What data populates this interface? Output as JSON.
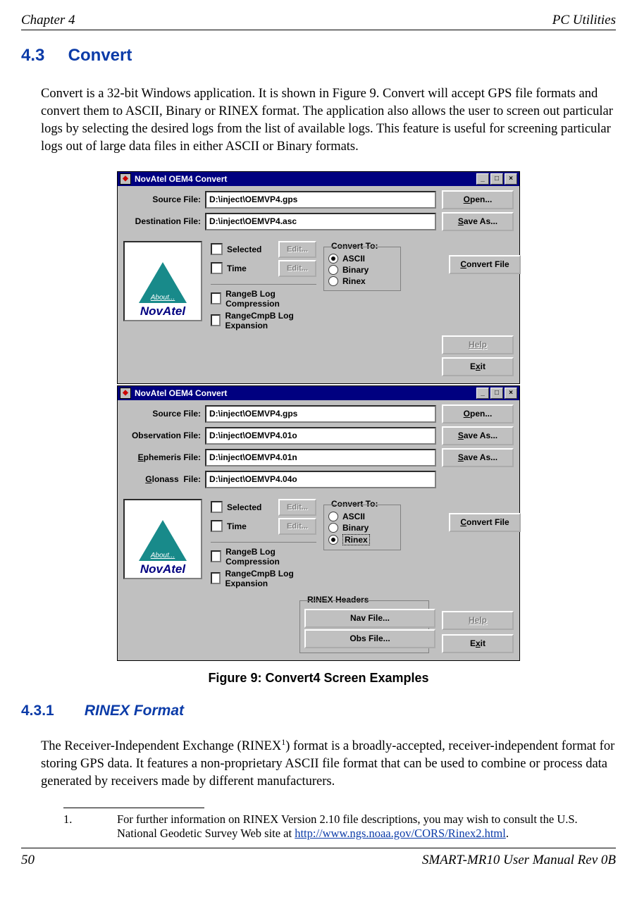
{
  "header": {
    "left": "Chapter 4",
    "right": "PC Utilities"
  },
  "section": {
    "num": "4.3",
    "title": "Convert"
  },
  "para1": "Convert is a 32-bit Windows application. It is shown in Figure 9. Convert will accept GPS file formats and convert them to ASCII, Binary or RINEX format. The application also allows the user to screen out particular logs by selecting the desired logs from the list of available logs. This feature is useful for screening particular logs out of large data files in either ASCII or Binary formats.",
  "figure_caption": "Figure 9: Convert4 Screen Examples",
  "win_title": "NovAtel OEM4 Convert",
  "labels": {
    "source": "Source File:",
    "dest": "Destination File:",
    "obs": "Observation File:",
    "eph": "Ephemeris File:",
    "glo": "Glonass  File:",
    "open": "Open...",
    "saveas": "Save As...",
    "selected": "Selected",
    "time": "Time",
    "edit": "Edit...",
    "rangeb": "RangeB Log Compression",
    "rangecmp": "RangeCmpB Log Expansion",
    "convert_to": "Convert To:",
    "ascii": "ASCII",
    "binary": "Binary",
    "rinex": "Rinex",
    "convert_file": "Convert File",
    "help": "Help",
    "exit": "Exit",
    "rinex_headers": "RINEX Headers",
    "navfile": "Nav File...",
    "obsfile": "Obs File...",
    "about": "About...",
    "novatel": "NovAtel"
  },
  "paths": {
    "src": "D:\\inject\\OEMVP4.gps",
    "dst_asc": "D:\\inject\\OEMVP4.asc",
    "obs": "D:\\inject\\OEMVP4.01o",
    "eph": "D:\\inject\\OEMVP4.01n",
    "glo": "D:\\inject\\OEMVP4.04o"
  },
  "subsection": {
    "num": "4.3.1",
    "title": "RINEX Format"
  },
  "para2a": "The Receiver-Independent Exchange (RINEX",
  "para2b": ") format is a broadly-accepted, receiver-independent format for storing GPS data. It features a non-proprietary ASCII file format that can be used to combine or process data generated by receivers made by different manufacturers.",
  "footnote": {
    "num": "1.",
    "text_a": "For further information on RINEX Version 2.10 file descriptions, you may wish to consult the U.S. National Geodetic Survey Web site at ",
    "link": "http://www.ngs.noaa.gov/CORS/Rinex2.html",
    "text_b": "."
  },
  "footer": {
    "left": "50",
    "right": "SMART-MR10 User Manual Rev 0B"
  }
}
